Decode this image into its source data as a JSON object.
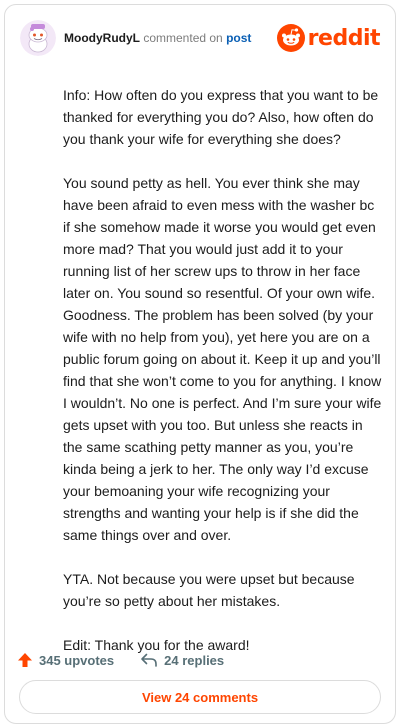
{
  "header": {
    "username": "MoodyRudyL",
    "commented_on": "commented on",
    "post_link": "post",
    "brand": "reddit"
  },
  "comment": {
    "paragraphs": [
      "Info: How often do you express that you want to be thanked for everything you do? Also, how often do you thank your wife for everything she does?",
      "You sound petty as hell. You ever think she may have been afraid to even mess with the washer bc if she somehow made it worse you would get even more mad? That you would just add it to your running list of her screw ups to throw in her face later on. You sound so resentful. Of your own wife. Goodness. The problem has been solved (by your wife with no help from you), yet here you are on a public forum going on about it. Keep it up and you’ll find that she won’t come to you for anything. I know I wouldn’t. No one is perfect. And I’m sure your wife gets upset with you too. But unless she reacts in the same scathing petty manner as you, you’re kinda being a jerk to her. The only way I’d excuse your bemoaning your wife recognizing your strengths and wanting your help is if she did the same things over and over.",
      "YTA. Not because you were upset but because you’re so petty about her mistakes.",
      "Edit: Thank you for the award!"
    ]
  },
  "actions": {
    "upvotes": "345 upvotes",
    "replies": "24 replies",
    "view_comments": "View 24 comments"
  },
  "colors": {
    "brand": "#ff4500",
    "link": "#0a5fb4",
    "muted": "#7c7c7c",
    "action": "#576f76"
  },
  "icons": {
    "avatar": "snoo-avatar",
    "brand": "reddit-snoo-icon",
    "upvote": "upvote-arrow-icon",
    "reply": "reply-arrow-icon"
  }
}
